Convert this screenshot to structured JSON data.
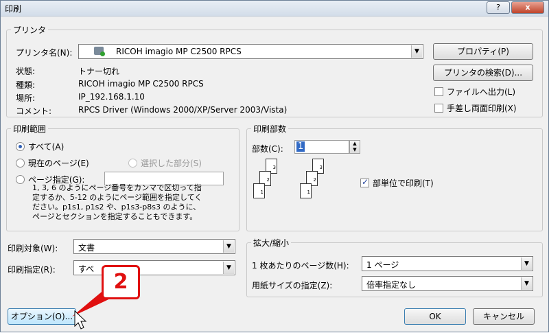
{
  "window": {
    "title": "印刷",
    "help_label": "?",
    "close_label": "x"
  },
  "printer": {
    "group_title": "プリンタ",
    "name_label": "プリンタ名(N):",
    "name_value": "RICOH imagio MP C2500 RPCS",
    "status_label": "状態:",
    "status_value": "トナー切れ",
    "type_label": "種類:",
    "type_value": "RICOH imagio MP C2500 RPCS",
    "location_label": "場所:",
    "location_value": "IP_192.168.1.10",
    "comment_label": "コメント:",
    "comment_value": "RPCS Driver (Windows 2000/XP/Server 2003/Vista)",
    "properties_button": "プロパティ(P)",
    "find_printer_button": "プリンタの検索(D)...",
    "print_to_file_label": "ファイルへ出力(L)",
    "manual_duplex_label": "手差し両面印刷(X)"
  },
  "range": {
    "group_title": "印刷範囲",
    "all_label": "すべて(A)",
    "current_page_label": "現在のページ(E)",
    "selection_label": "選択した部分(S)",
    "pages_label": "ページ指定(G):",
    "pages_value": "",
    "note": "1, 3, 6 のようにページ番号をカンマで区切って指\n定するか、5-12 のようにページ範囲を指定してく\nださい。p1s1, p1s2 や、p1s3-p8s3 のように、\nページとセクションを指定することもできます。"
  },
  "copies": {
    "group_title": "印刷部数",
    "count_label": "部数(C):",
    "count_value": "1",
    "collate_label": "部単位で印刷(T)",
    "collate_checked": true
  },
  "print_what": {
    "label": "印刷対象(W):",
    "value": "文書"
  },
  "print_setting": {
    "label": "印刷指定(R):",
    "value": "すべ"
  },
  "zoom": {
    "group_title": "拡大/縮小",
    "pages_per_sheet_label": "1 枚あたりのページ数(H):",
    "pages_per_sheet_value": "1 ページ",
    "scale_label": "用紙サイズの指定(Z):",
    "scale_value": "倍率指定なし"
  },
  "footer": {
    "options_button": "オプション(O)...",
    "ok_button": "OK",
    "cancel_button": "キャンセル"
  },
  "callout": {
    "number": "2",
    "color": "#e01010"
  }
}
